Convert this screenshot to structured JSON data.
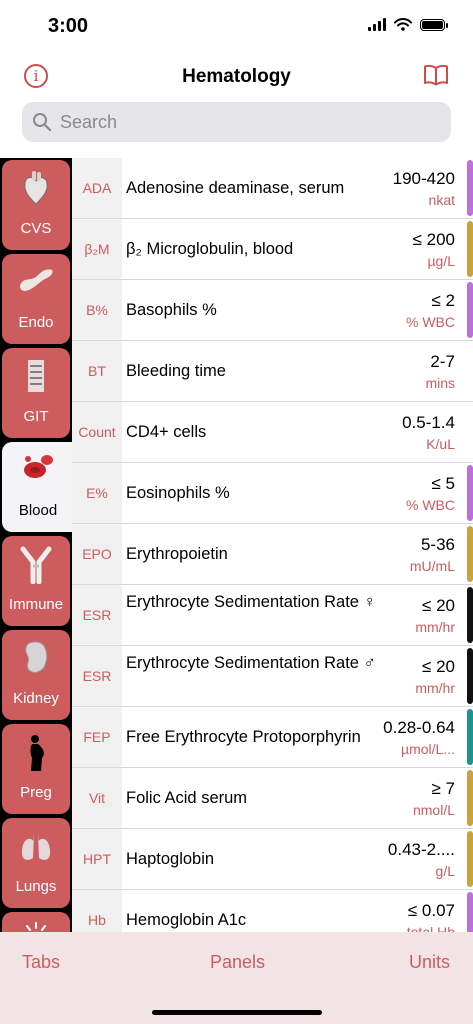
{
  "status": {
    "time": "3:00"
  },
  "nav": {
    "title": "Hematology"
  },
  "search": {
    "placeholder": "Search"
  },
  "sidebar": {
    "tabs": [
      {
        "label": "CVS"
      },
      {
        "label": "Endo"
      },
      {
        "label": "GIT"
      },
      {
        "label": "Blood",
        "active": true
      },
      {
        "label": "Immune"
      },
      {
        "label": "Kidney"
      },
      {
        "label": "Preg"
      },
      {
        "label": "Lungs"
      },
      {
        "label": ""
      }
    ]
  },
  "rows": [
    {
      "abbr": "ADA",
      "name": "Adenosine deaminase, serum",
      "value": "190-420",
      "unit": "nkat",
      "color": "#c06de0"
    },
    {
      "abbr": "β₂M",
      "name": "β₂ Microglobulin, blood",
      "value": "≤ 200",
      "unit": "µg/L",
      "color": "#c9a23a"
    },
    {
      "abbr": "B%",
      "name": "Basophils %",
      "value": "≤ 2",
      "unit": "% WBC",
      "color": "#c06de0"
    },
    {
      "abbr": "BT",
      "name": "Bleeding time",
      "value": "2-7",
      "unit": "mins",
      "color": ""
    },
    {
      "abbr": "Count",
      "name": "CD4+ cells",
      "value": "0.5-1.4",
      "unit": "K/uL",
      "color": ""
    },
    {
      "abbr": "E%",
      "name": "Eosinophils %",
      "value": "≤ 5",
      "unit": "% WBC",
      "color": "#c06de0"
    },
    {
      "abbr": "EPO",
      "name": "Erythropoietin",
      "value": "5-36",
      "unit": "mU/mL",
      "color": "#c9a23a"
    },
    {
      "abbr": "ESR",
      "name": "Erythrocyte Sedimentation Rate ♀",
      "value": "≤ 20",
      "unit": "mm/hr",
      "color": "#111111"
    },
    {
      "abbr": "ESR",
      "name": "Erythrocyte Sedimentation Rate ♂",
      "value": "≤ 20",
      "unit": "mm/hr",
      "color": "#111111"
    },
    {
      "abbr": "FEP",
      "name": "Free Erythrocyte Protoporphyrin",
      "value": "0.28-0.64",
      "unit": "µmol/L...",
      "color": "#1a9393"
    },
    {
      "abbr": "Vit",
      "name": "Folic Acid serum",
      "value": "≥ 7",
      "unit": "nmol/L",
      "color": "#c9a23a"
    },
    {
      "abbr": "HPT",
      "name": "Haptoglobin",
      "value": "0.43-2....",
      "unit": "g/L",
      "color": "#c9a23a"
    },
    {
      "abbr": "Hb",
      "name": "Hemoglobin A1c",
      "value": "≤ 0.07",
      "unit": "total Hb",
      "color": "#c06de0"
    }
  ],
  "tabbar": {
    "tabs": "Tabs",
    "panels": "Panels",
    "units": "Units"
  },
  "colors": {
    "accent": "#cc5c5e",
    "sidebar_tab": "#cc5c5e",
    "tabbar_bg": "#f2e4e4"
  },
  "icons": {
    "info": "info-circle-icon",
    "book": "open-book-icon",
    "search": "magnifier-icon",
    "tabs": [
      "heart-icon",
      "pancreas-icon",
      "intestine-icon",
      "blood-cells-icon",
      "antibody-icon",
      "kidney-icon",
      "pregnancy-icon",
      "lungs-icon",
      "sun-icon"
    ]
  }
}
